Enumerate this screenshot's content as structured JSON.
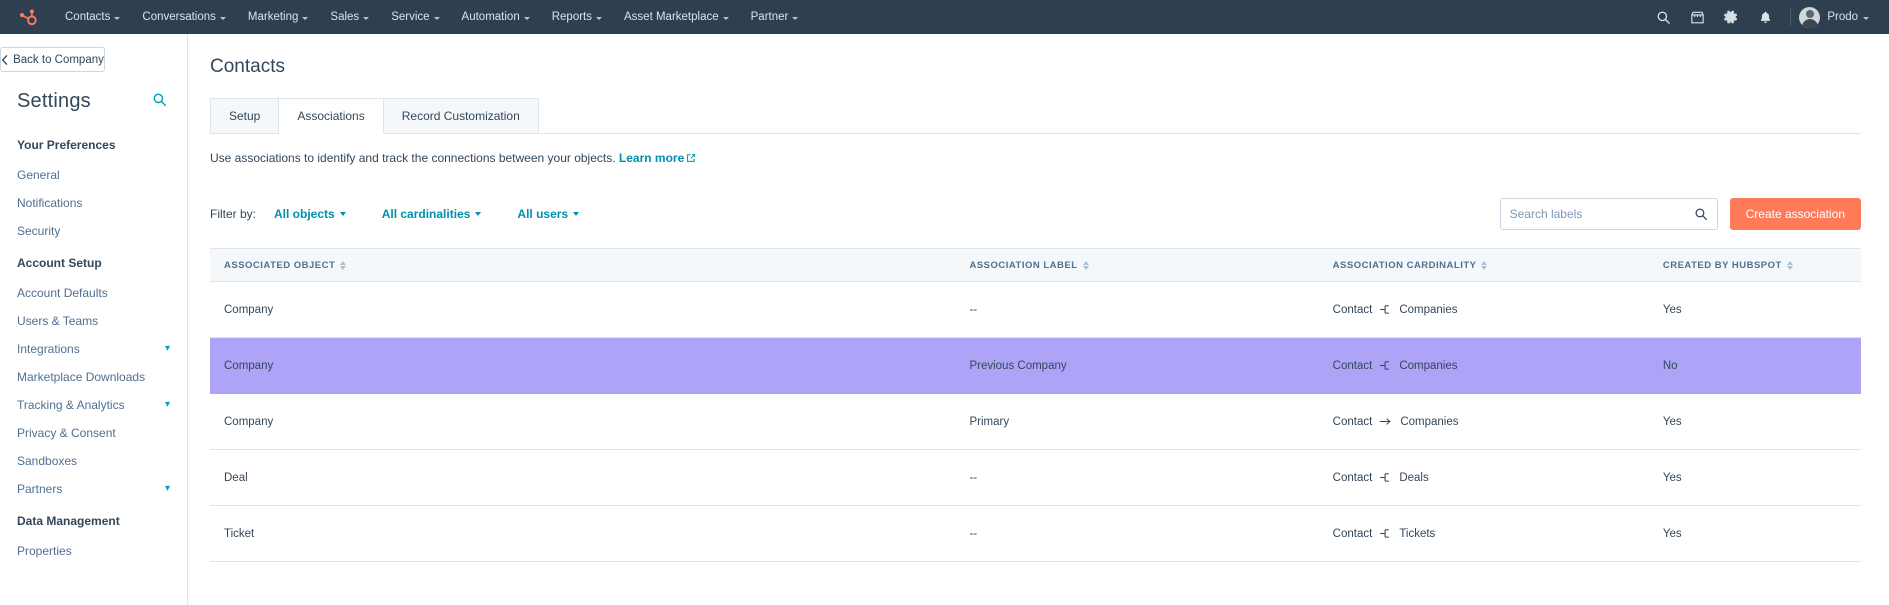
{
  "topnav": {
    "logo": "hubspot-sprocket-logo",
    "menu": [
      {
        "label": "Contacts",
        "has_caret": true
      },
      {
        "label": "Conversations",
        "has_caret": true
      },
      {
        "label": "Marketing",
        "has_caret": true
      },
      {
        "label": "Sales",
        "has_caret": true
      },
      {
        "label": "Service",
        "has_caret": true
      },
      {
        "label": "Automation",
        "has_caret": true
      },
      {
        "label": "Reports",
        "has_caret": true
      },
      {
        "label": "Asset Marketplace",
        "has_caret": true
      },
      {
        "label": "Partner",
        "has_caret": true
      }
    ],
    "icons": [
      "search-icon",
      "marketplace-icon",
      "gear-icon",
      "notifications-bell-icon"
    ],
    "user": "Prodo"
  },
  "sidebar": {
    "back_label": "Back to Company",
    "title": "Settings",
    "search_icon": "search-icon",
    "sections": [
      {
        "label": "Your Preferences",
        "items": [
          {
            "label": "General",
            "chevron": false
          },
          {
            "label": "Notifications",
            "chevron": false
          },
          {
            "label": "Security",
            "chevron": false
          }
        ]
      },
      {
        "label": "Account Setup",
        "items": [
          {
            "label": "Account Defaults",
            "chevron": false
          },
          {
            "label": "Users & Teams",
            "chevron": false
          },
          {
            "label": "Integrations",
            "chevron": true
          },
          {
            "label": "Marketplace Downloads",
            "chevron": false
          },
          {
            "label": "Tracking & Analytics",
            "chevron": true
          },
          {
            "label": "Privacy & Consent",
            "chevron": false
          },
          {
            "label": "Sandboxes",
            "chevron": false
          },
          {
            "label": "Partners",
            "chevron": true
          }
        ]
      },
      {
        "label": "Data Management",
        "items": [
          {
            "label": "Properties",
            "chevron": false
          }
        ]
      }
    ]
  },
  "main": {
    "page_title": "Contacts",
    "tabs": [
      {
        "label": "Setup",
        "active": false
      },
      {
        "label": "Associations",
        "active": true
      },
      {
        "label": "Record Customization",
        "active": false
      }
    ],
    "description": "Use associations to identify and track the connections between your objects.",
    "learn_more": "Learn more",
    "filter_label": "Filter by:",
    "filters": [
      {
        "label": "All objects"
      },
      {
        "label": "All cardinalities"
      },
      {
        "label": "All users"
      }
    ],
    "search": {
      "value": "",
      "placeholder": "Search labels"
    },
    "create_button": "Create association",
    "table": {
      "headers": [
        "ASSOCIATED OBJECT",
        "ASSOCIATION LABEL",
        "ASSOCIATION CARDINALITY",
        "CREATED BY HUBSPOT"
      ],
      "rows": [
        {
          "object": "Company",
          "label": "--",
          "cardinality_from": "Contact",
          "cardinality_icon": "one-to-many-icon",
          "cardinality_to": "Companies",
          "created_by_hubspot": "Yes",
          "selected": false
        },
        {
          "object": "Company",
          "label": "Previous Company",
          "cardinality_from": "Contact",
          "cardinality_icon": "one-to-many-icon",
          "cardinality_to": "Companies",
          "created_by_hubspot": "No",
          "selected": true
        },
        {
          "object": "Company",
          "label": "Primary",
          "cardinality_from": "Contact",
          "cardinality_icon": "one-to-one-arrow-icon",
          "cardinality_to": "Companies",
          "created_by_hubspot": "Yes",
          "selected": false
        },
        {
          "object": "Deal",
          "label": "--",
          "cardinality_from": "Contact",
          "cardinality_icon": "one-to-many-icon",
          "cardinality_to": "Deals",
          "created_by_hubspot": "Yes",
          "selected": false
        },
        {
          "object": "Ticket",
          "label": "--",
          "cardinality_from": "Contact",
          "cardinality_icon": "one-to-many-icon",
          "cardinality_to": "Tickets",
          "created_by_hubspot": "Yes",
          "selected": false
        }
      ]
    }
  },
  "colors": {
    "nav_bg": "#2e3f50",
    "brand_orange": "#ff7a59",
    "link_teal": "#0091ae",
    "selected_row": "#ada4f7",
    "text": "#33475b"
  }
}
